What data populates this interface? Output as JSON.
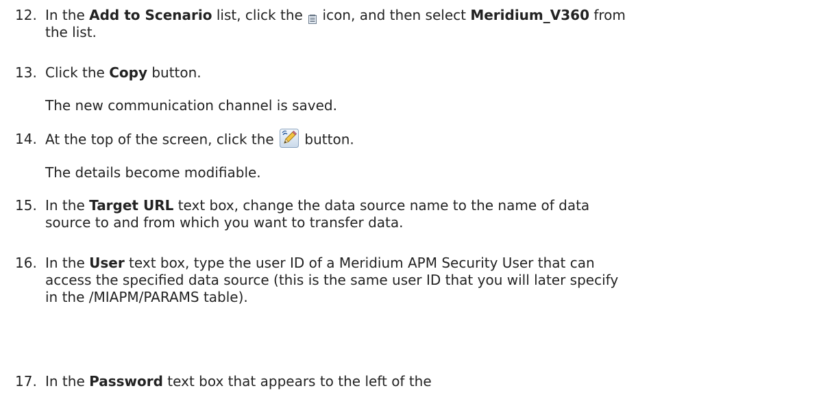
{
  "steps": [
    {
      "num": "12.",
      "t1": "In the ",
      "b1": "Add to Scenario",
      "t2": " list, click the ",
      "icon": "list-icon",
      "t3": " icon, and then select ",
      "b2": "Meridium_V360",
      "t4": " from",
      "line2": "the list."
    },
    {
      "num": "13.",
      "t1": "Click the ",
      "b1": "Copy",
      "t2": " button."
    },
    {
      "result": "The new communication channel is saved."
    },
    {
      "num": "14.",
      "t1": "At the top of the screen, click the ",
      "icon": "edit-pencil-icon",
      "t2": " button."
    },
    {
      "result": "The details become modifiable."
    },
    {
      "num": "15.",
      "t1": "In the ",
      "b1": "Target URL",
      "t2": " text box, change the data source name to the name of data",
      "line2": "source to and from which you want to transfer data."
    },
    {
      "num": "16.",
      "t1": "In the ",
      "b1": "User",
      "t2": " text box, type the user ID of a Meridium APM Security User that can",
      "line2": "access the specified data source (this is the same user ID that you will later specify",
      "line3": "in the /MIAPM/PARAMS table)."
    },
    {
      "num": "17.",
      "t1": "In the ",
      "b1": "Password",
      "t2": " text box that appears to the left of the"
    }
  ]
}
